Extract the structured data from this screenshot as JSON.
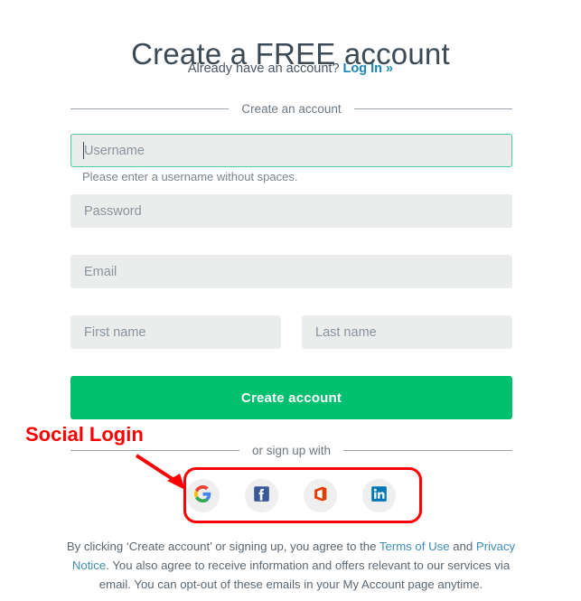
{
  "header": {
    "title": "Create a FREE account",
    "subtitle_prefix": "Already have an account? ",
    "login_link": "Log In »"
  },
  "dividers": {
    "create_account": "Create an account",
    "or_sign_up": "or sign up with"
  },
  "form": {
    "username": {
      "placeholder": "Username",
      "value": "",
      "helper": "Please enter a username without spaces.",
      "focused": true,
      "focus_border_color": "#4ecb96"
    },
    "password": {
      "placeholder": "Password",
      "value": ""
    },
    "email": {
      "placeholder": "Email",
      "value": ""
    },
    "first_name": {
      "placeholder": "First name",
      "value": ""
    },
    "last_name": {
      "placeholder": "Last name",
      "value": ""
    },
    "submit_label": "Create account",
    "submit_color": "#00bf6f"
  },
  "social": {
    "buttons": [
      {
        "name": "google-icon",
        "label": "Google"
      },
      {
        "name": "facebook-icon",
        "label": "Facebook"
      },
      {
        "name": "microsoft-office-icon",
        "label": "Office"
      },
      {
        "name": "linkedin-icon",
        "label": "LinkedIn"
      }
    ]
  },
  "legal": {
    "part1": "By clicking ‘Create account’ or signing up, you agree to the ",
    "terms_link": "Terms of Use",
    "part2": " and ",
    "privacy_link": "Privacy Notice",
    "part3": ". You also agree to receive information and offers relevant to our services via email. You can opt-out of these emails in your My Account page anytime."
  },
  "annotation": {
    "label": "Social Login",
    "color": "#ff0000"
  }
}
